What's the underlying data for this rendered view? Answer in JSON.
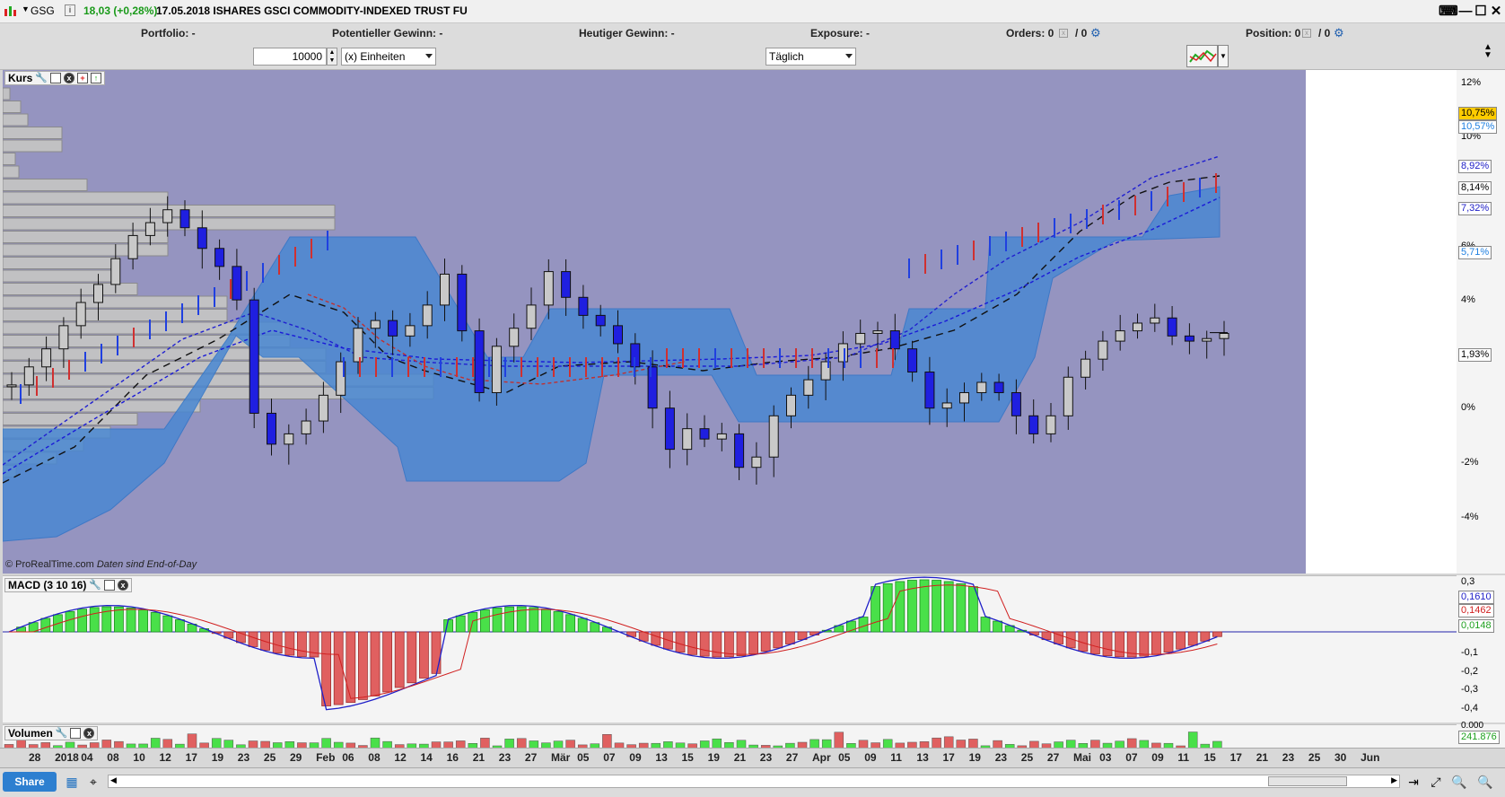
{
  "titlebar": {
    "symbol": "GSG",
    "price": "18,03 (+0,28%)",
    "date_name": "17.05.2018 ISHARES GSCI COMMODITY-INDEXED TRUST FU",
    "btn_close": "✕",
    "btn_max": "☐",
    "btn_min": "—",
    "btn_kbd": "⌨"
  },
  "infobar": {
    "portfolio": "Portfolio: -",
    "potentieller": "Potentieller Gewinn: -",
    "heutiger": "Heutiger Gewinn: -",
    "exposure": "Exposure: -",
    "orders": "Orders: 0",
    "orders_b": "/ 0",
    "position": "Position: 0",
    "position_b": "/ 0"
  },
  "controls": {
    "quantity": "10000",
    "unit_select": "(x) Einheiten",
    "interval_select": "Täglich"
  },
  "price_panel": {
    "title": "Kurs",
    "credit": "© ProRealTime.com Daten sind End-of-Day",
    "credit_a": "© ProRealTime.com",
    "credit_b": "Daten sind End-of-Day"
  },
  "price_axis": {
    "labels": [
      "12%",
      "10%",
      "6%",
      "4%",
      "2%",
      "0%",
      "-2%",
      "-4%"
    ],
    "tags": [
      {
        "text": "10,75%",
        "bg": "#ffcc00",
        "fg": "#000"
      },
      {
        "text": "10,57%",
        "bg": "#fff",
        "fg": "#1e7fe0"
      },
      {
        "text": "8,92%",
        "bg": "#fff",
        "fg": "#2020c8"
      },
      {
        "text": "8,14%",
        "bg": "#fff",
        "fg": "#000"
      },
      {
        "text": "7,32%",
        "bg": "#fff",
        "fg": "#2020c8"
      },
      {
        "text": "5,71%",
        "bg": "#fff",
        "fg": "#1e7fe0"
      },
      {
        "text": "1,93%",
        "bg": "#fff",
        "fg": "#000"
      }
    ]
  },
  "macd_panel": {
    "title": "MACD (3 10 16)",
    "axis": [
      "0,3",
      "-0,1",
      "-0,2",
      "-0,3",
      "-0,4"
    ],
    "tags": [
      {
        "text": "0,1610",
        "fg": "#2020c8"
      },
      {
        "text": "0,1462",
        "fg": "#d02020"
      },
      {
        "text": "0,0148",
        "fg": "#1fa01f"
      }
    ]
  },
  "volume_panel": {
    "title": "Volumen",
    "value": "241.876",
    "value_cut": "0.000"
  },
  "x_axis": {
    "labels": [
      "28",
      "2018",
      "04",
      "08",
      "10",
      "12",
      "17",
      "19",
      "23",
      "25",
      "29",
      "Feb",
      "06",
      "08",
      "12",
      "14",
      "16",
      "21",
      "23",
      "27",
      "Mär",
      "05",
      "07",
      "09",
      "13",
      "15",
      "19",
      "21",
      "23",
      "27",
      "Apr",
      "05",
      "09",
      "11",
      "13",
      "17",
      "19",
      "23",
      "25",
      "27",
      "Mai",
      "03",
      "07",
      "09",
      "11",
      "15",
      "17",
      "21",
      "23",
      "25",
      "30",
      "Jun"
    ]
  },
  "status": {
    "share": "Share"
  },
  "colors": {
    "bg_panel": "#9594c0",
    "cloud": "#4a88d2",
    "bull": "#1f1fe0",
    "bear": "#c9c9c9",
    "macd_pos": "#49e049",
    "macd_neg": "#e06060"
  }
}
